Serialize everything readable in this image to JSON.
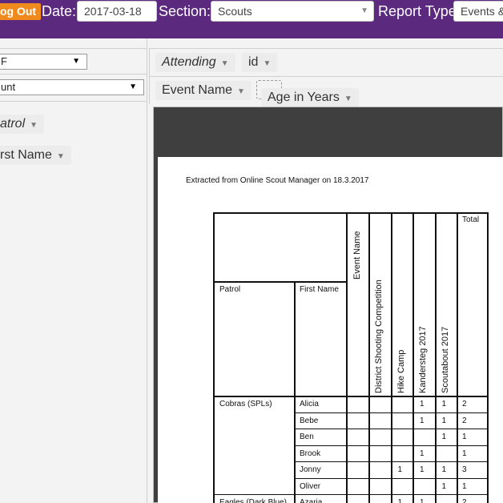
{
  "topbar": {
    "logout_label": "og Out",
    "date_label": "Date:",
    "date_value": "2017-03-18",
    "section_label": "Section:",
    "section_value": "Scouts",
    "report_type_label": "Report Type:",
    "report_type_value": "Events &"
  },
  "left_panel": {
    "select1_value": "F",
    "select2_value": "unt",
    "pill_patrol": "atrol",
    "pill_first_name": "rst Name"
  },
  "header": {
    "attending": "Attending",
    "id": "id",
    "event_name": "Event Name",
    "age_in_years": "Age in Years"
  },
  "report": {
    "extract_text": "Extracted from Online Scout Manager on 18.3.2017",
    "col_patrol": "Patrol",
    "col_first_name": "First Name",
    "col_event_name": "Event Name",
    "col_total": "Total",
    "events": [
      "District Shooting Competition",
      "Hike Camp",
      "Kandersteg 2017",
      "Scoutabout 2017"
    ],
    "rows": [
      {
        "patrol": "Cobras (SPLs)",
        "name": "Alicia",
        "cells": [
          "",
          "",
          "1",
          "1"
        ],
        "total": "2"
      },
      {
        "patrol": "",
        "name": "Bebe",
        "cells": [
          "",
          "",
          "1",
          "1"
        ],
        "total": "2"
      },
      {
        "patrol": "",
        "name": "Ben",
        "cells": [
          "",
          "",
          "",
          "1"
        ],
        "total": "1"
      },
      {
        "patrol": "",
        "name": "Brook",
        "cells": [
          "",
          "",
          "1",
          ""
        ],
        "total": "1"
      },
      {
        "patrol": "",
        "name": "Jonny",
        "cells": [
          "",
          "1",
          "1",
          "1"
        ],
        "total": "3"
      },
      {
        "patrol": "",
        "name": "Oliver",
        "cells": [
          "",
          "",
          "",
          "1"
        ],
        "total": "1"
      },
      {
        "patrol": "Eagles (Dark Blue)",
        "name": "Azaria",
        "cells": [
          "",
          "1",
          "1",
          ""
        ],
        "total": "2"
      }
    ]
  },
  "icons": {
    "caret": "dropdown-caret-icon"
  }
}
